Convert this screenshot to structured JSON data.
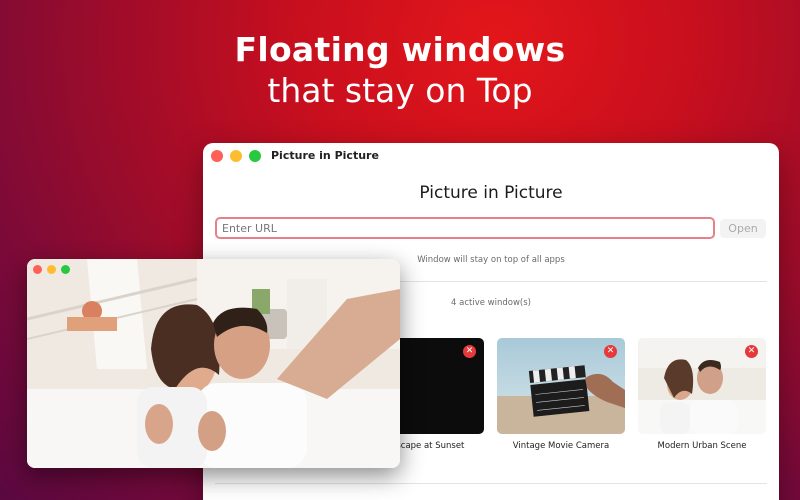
{
  "hero": {
    "line1": "Floating windows",
    "line2": "that stay on Top"
  },
  "window": {
    "title": "Picture in Picture",
    "heading": "Picture in Picture",
    "url_placeholder": "Enter URL",
    "open_label": "Open",
    "hint": "Window will stay on top of all apps",
    "active_count": "4 active window(s)"
  },
  "cards": [
    {
      "label": "Landscape at Sunset"
    },
    {
      "label": "Vintage Movie Camera"
    },
    {
      "label": "Modern Urban Scene"
    }
  ],
  "icons": {
    "close": "close-icon",
    "play": "play-icon"
  },
  "colors": {
    "accent": "#e5393b",
    "url_border": "#e8808a"
  }
}
